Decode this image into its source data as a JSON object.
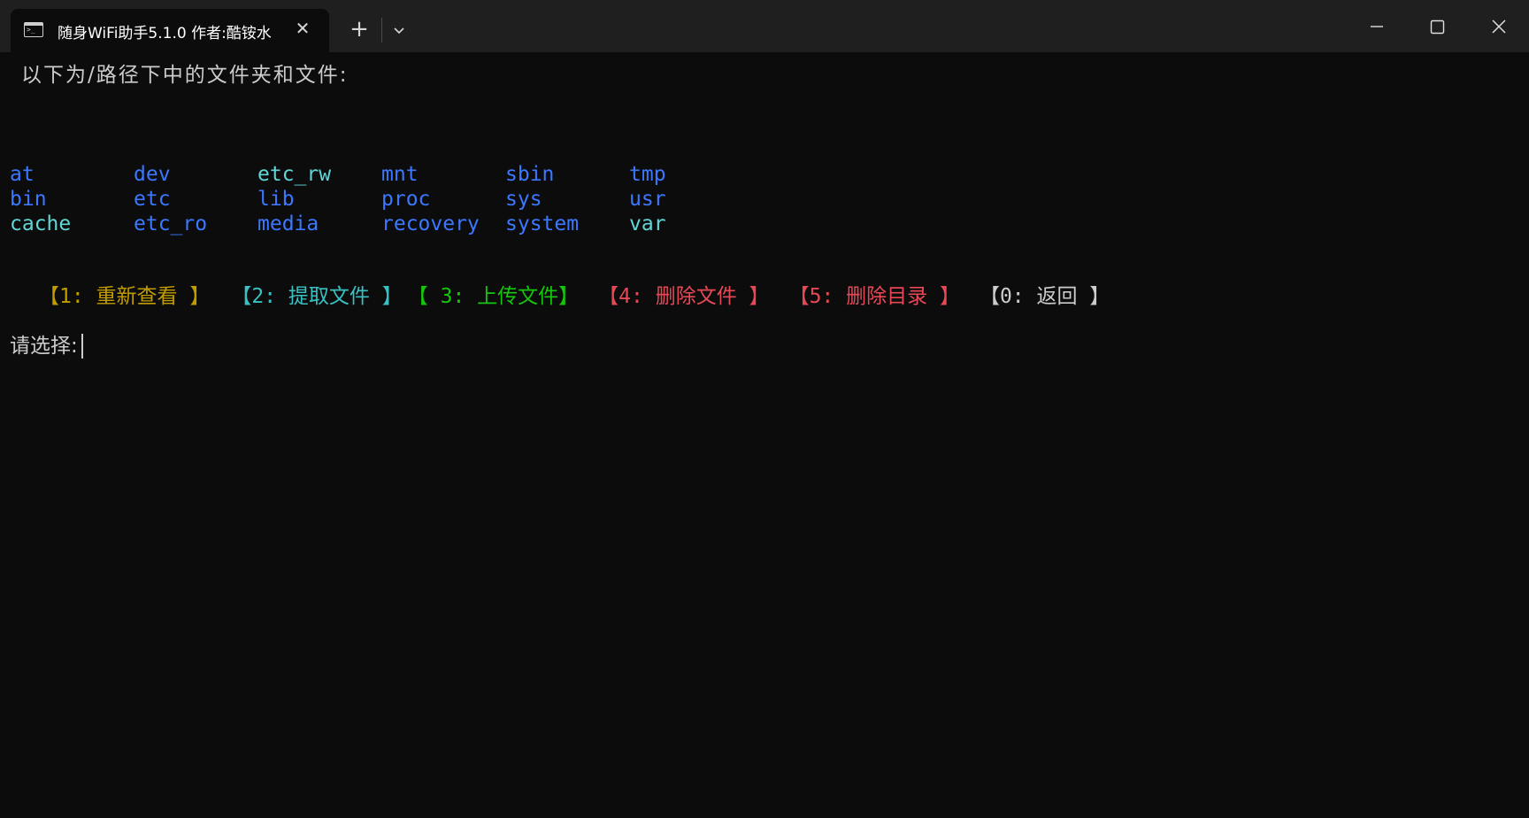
{
  "window": {
    "tab_title": "随身WiFi助手5.1.0 作者:酷铵水",
    "tab_icon": "terminal-icon",
    "tab_icon_text": ">_",
    "close_tab_symbol": "✕",
    "new_tab_symbol": "+",
    "dropdown_icon": "chevron-down-icon",
    "controls": [
      "minimize-icon",
      "maximize-icon",
      "close-icon"
    ]
  },
  "terminal": {
    "background": "#0c0c0c",
    "header": "以下为/路径下中的文件夹和文件:",
    "entries": [
      {
        "name": "at",
        "color": "#3b78ff"
      },
      {
        "name": "bin",
        "color": "#3b78ff"
      },
      {
        "name": "cache",
        "color": "#61d6d6"
      },
      {
        "name": "dev",
        "color": "#3b78ff"
      },
      {
        "name": "etc",
        "color": "#3b78ff"
      },
      {
        "name": "etc_ro",
        "color": "#3b78ff"
      },
      {
        "name": "etc_rw",
        "color": "#61d6d6"
      },
      {
        "name": "lib",
        "color": "#3b78ff"
      },
      {
        "name": "media",
        "color": "#3b78ff"
      },
      {
        "name": "mnt",
        "color": "#3b78ff"
      },
      {
        "name": "proc",
        "color": "#3b78ff"
      },
      {
        "name": "recovery",
        "color": "#3b78ff"
      },
      {
        "name": "sbin",
        "color": "#3b78ff"
      },
      {
        "name": "sys",
        "color": "#3b78ff"
      },
      {
        "name": "system",
        "color": "#3b78ff"
      },
      {
        "name": "tmp",
        "color": "#3b78ff"
      },
      {
        "name": "usr",
        "color": "#3b78ff"
      },
      {
        "name": "var",
        "color": "#61d6d6"
      }
    ],
    "menu": {
      "opt1": "【1: 重新查看 】",
      "opt2": "【2: 提取文件 】",
      "opt3": "【 3: 上传文件】",
      "opt4": "【4: 删除文件 】",
      "opt5": "【5: 删除目录 】",
      "opt0": "【0: 返回 】",
      "colors": {
        "opt1": "#c19c00",
        "opt2": "#3ac1c4",
        "opt3": "#16c60c",
        "opt4": "#e74856",
        "opt5": "#e74856",
        "opt0": "#cccccc"
      }
    },
    "prompt": "请选择:"
  }
}
